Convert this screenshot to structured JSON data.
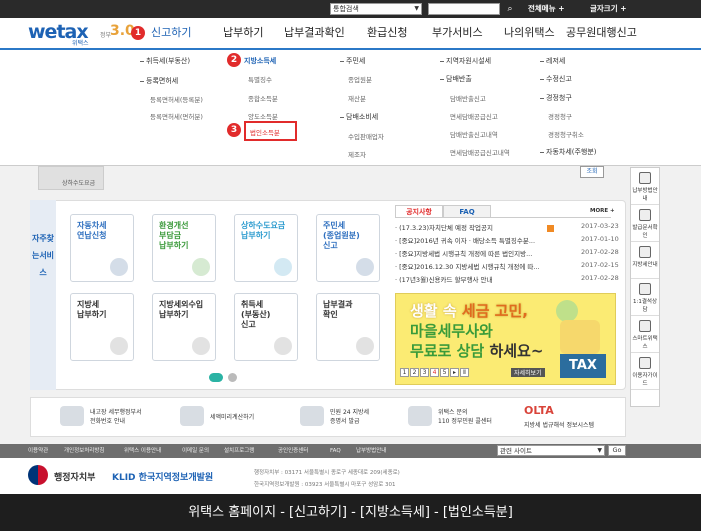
{
  "topbar": {
    "search_select": "통합검색",
    "search_input": "",
    "all_menu": "전체메뉴",
    "font_size": "글자크기"
  },
  "logo": {
    "brand": "wetax",
    "sub": "위택스",
    "badge": "3.0",
    "badge_prefix": "정부"
  },
  "markers": {
    "m1": "1",
    "m2": "2",
    "m3": "3"
  },
  "gnb": [
    "신고하기",
    "납부하기",
    "납부결과확인",
    "환급신청",
    "부가서비스",
    "나의위택스",
    "공무원대행신고"
  ],
  "dropdown": {
    "col1": {
      "h1": "취득세(부동산)",
      "h2": "등록면허세",
      "items": [
        "등록면허세(등록분)",
        "등록면허세(면허분)"
      ]
    },
    "col2": {
      "h": "지방소득세",
      "items": [
        "특별징수",
        "종합소득분",
        "양도소득분",
        "법인소득분"
      ]
    },
    "col3": {
      "h1": "주민세",
      "items1": [
        "종업원분",
        "재산분"
      ],
      "h2": "담배소비세",
      "items2": [
        "수입판매업자",
        "제조자"
      ]
    },
    "col4": {
      "h1": "지역자원시설세",
      "h2": "담배반출",
      "items": [
        "담배반출신고",
        "면세담배공급신고",
        "담배반출신고내역",
        "면세담배공급신고내역"
      ]
    },
    "col5": {
      "h1": "레저세",
      "h2": "수정신고",
      "h3": "경정청구",
      "items": [
        "경정청구",
        "경정청구취소"
      ],
      "h4": "자동차세(주행분)"
    }
  },
  "partial": {
    "left": "상하수도요금",
    "search_btn": "조회"
  },
  "vtitle": "자주찾는서비스",
  "cards": [
    {
      "t1": "자동차세",
      "t2": "연납신청",
      "t3": ""
    },
    {
      "t1": "환경개선",
      "t2": "부담금",
      "t3": "납부하기"
    },
    {
      "t1": "상하수도요금",
      "t2": "납부하기",
      "t3": ""
    },
    {
      "t1": "주민세",
      "t2": "(종업원분)",
      "t3": "신고"
    },
    {
      "t1": "지방세",
      "t2": "납부하기",
      "t3": ""
    },
    {
      "t1": "지방세외수입",
      "t2": "납부하기",
      "t3": ""
    },
    {
      "t1": "취득세",
      "t2": "(부동산)",
      "t3": "신고"
    },
    {
      "t1": "납부결과",
      "t2": "확인",
      "t3": ""
    }
  ],
  "news": {
    "tab1": "공지사항",
    "tab2": "FAQ",
    "more": "MORE +",
    "rows": [
      {
        "t": "(17.3.23)자치단체 예정 작업공지",
        "d": "2017-03-23"
      },
      {
        "t": "[중요]2016년 귀속 이자 · 배당소득 특별징수분...",
        "d": "2017-01-10"
      },
      {
        "t": "[중요]지방세법 시행규칙 개정에 따른 법인지방...",
        "d": "2017-02-28"
      },
      {
        "t": "[중요]2016.12.30 지방세법 시행규칙 개정에 따...",
        "d": "2017-02-15"
      },
      {
        "t": "(17년3월)신용카드 할부행사 안내",
        "d": "2017-02-28"
      }
    ]
  },
  "banner": {
    "l1a": "생활 속 ",
    "l1b": "세금 고민,",
    "l2": "마을세무사와",
    "l3a": "무료로 상담 ",
    "l3b": "하세요~",
    "pages": [
      "1",
      "2",
      "3",
      "4",
      "5"
    ],
    "detail": "자세히보기",
    "tax": "TAX"
  },
  "sidebar": [
    "납부방법안내",
    "발급문서확인",
    "지방세안내",
    "1:1결석상담",
    "스마트위택스",
    "이용자가이드"
  ],
  "quick": [
    {
      "a": "내고장 세무행정부서",
      "b": "전화번호 안내"
    },
    {
      "a": "세액미리계산하기",
      "b": ""
    },
    {
      "a": "민원 24 지방세",
      "b": "증명서 발급"
    },
    {
      "a": "위택스 문의",
      "b": "110 정부민원 콜센터"
    },
    {
      "a": "지방세 법규해석 정보시스템",
      "b": ""
    }
  ],
  "qlogo": "OLTA",
  "footlinks": [
    "이용약관",
    "개인정보처리방침",
    "위택스 이용안내",
    "이메일 문의",
    "설치프로그램",
    "공인인증센터",
    "FAQ",
    "납부방법안내"
  ],
  "related": {
    "label": "관련 사이트",
    "go": "Go"
  },
  "org": {
    "a": "행정자치부",
    "b": "KLID 한국지역정보개발원",
    "addr1": "행정자치부 : 03171 서울특별시 종로구 세종대로 209(세종로)",
    "addr2": "한국지역정보개발원 : 03923 서울특별시 마포구 성암로 301"
  },
  "caption": "위택스 홈페이지 - [신고하기] - [지방소득세] - [법인소득분]"
}
